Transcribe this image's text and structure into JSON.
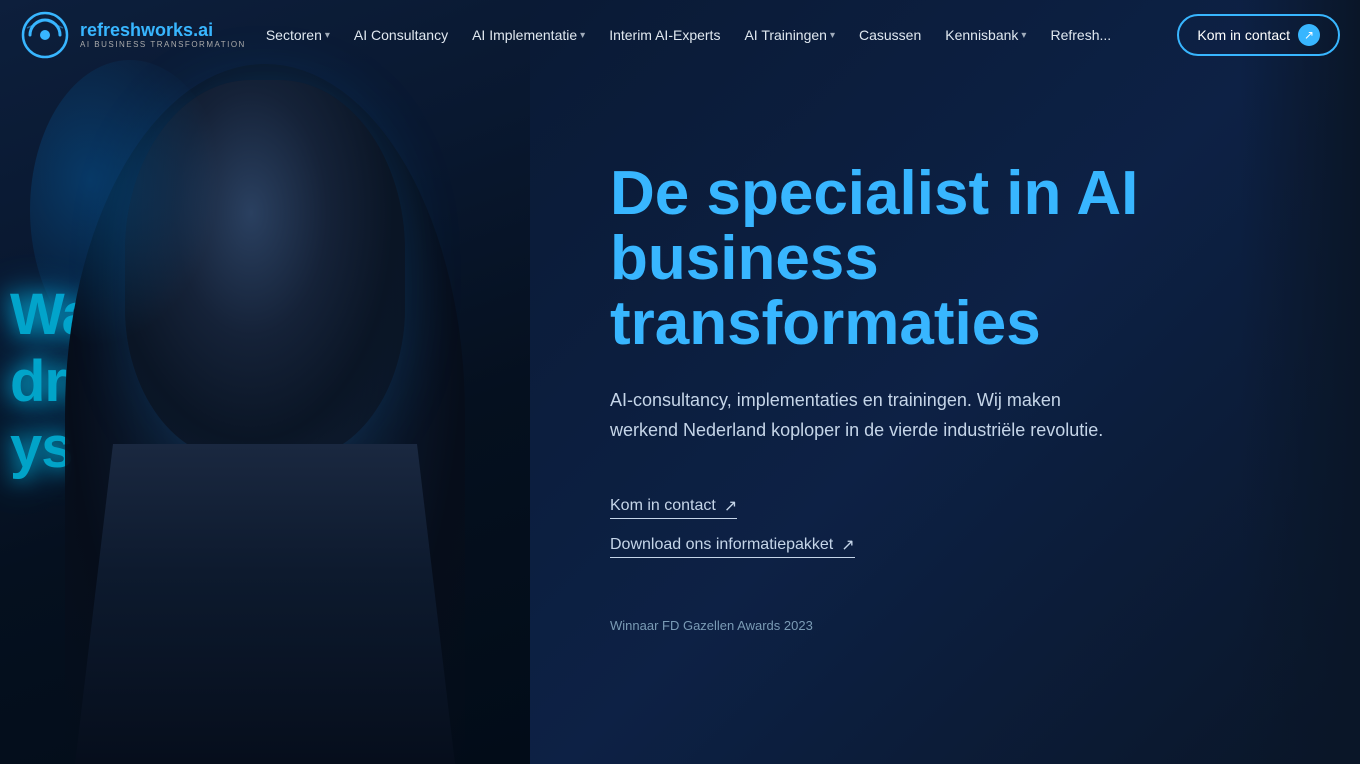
{
  "brand": {
    "name_part1": "refreshworks",
    "name_part2": ".ai",
    "tagline": "AI BUSINESS TRANSFORMATION"
  },
  "nav": {
    "items": [
      {
        "label": "Sectoren",
        "has_dropdown": true
      },
      {
        "label": "AI Consultancy",
        "has_dropdown": false
      },
      {
        "label": "AI Implementatie",
        "has_dropdown": true
      },
      {
        "label": "Interim AI-Experts",
        "has_dropdown": false
      },
      {
        "label": "AI Trainingen",
        "has_dropdown": true
      },
      {
        "label": "Casussen",
        "has_dropdown": false
      },
      {
        "label": "Kennisbank",
        "has_dropdown": true
      },
      {
        "label": "Refresh...",
        "has_dropdown": false
      }
    ],
    "cta": {
      "label": "Kom in contact",
      "arrow": "↗"
    }
  },
  "hero": {
    "title": "De specialist in AI business transformaties",
    "subtitle": "AI-consultancy, implementaties en trainingen. Wij maken werkend Nederland koploper in de vierde industriële revolutie.",
    "link1": {
      "text": "Kom in contact",
      "arrow": "↗"
    },
    "link2": {
      "text": "Download ons informatiepakket",
      "arrow": "↗"
    },
    "award": "Winnaar FD Gazellen Awards 2023"
  },
  "code_lines": [
    "Waar",
    "drukt en",
    "ys ten va"
  ]
}
